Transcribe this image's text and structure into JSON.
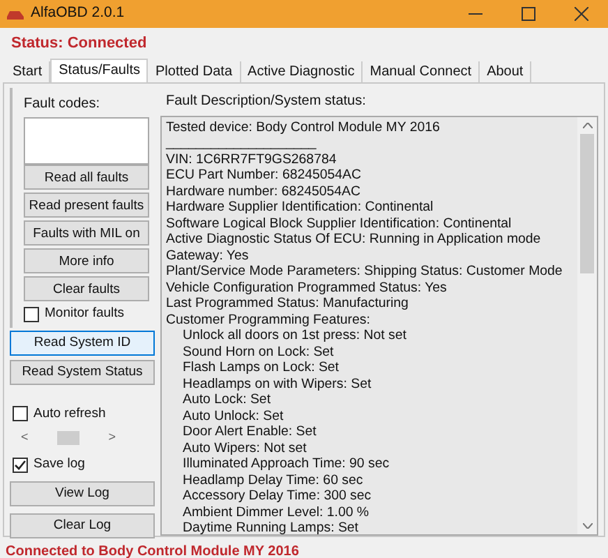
{
  "window": {
    "title": "AlfaOBD 2.0.1"
  },
  "status": "Status: Connected",
  "tabs": [
    {
      "label": "Start",
      "selected": false
    },
    {
      "label": "Status/Faults",
      "selected": true
    },
    {
      "label": "Plotted Data",
      "selected": false
    },
    {
      "label": "Active Diagnostic",
      "selected": false
    },
    {
      "label": "Manual Connect",
      "selected": false
    },
    {
      "label": "About",
      "selected": false
    }
  ],
  "fault_codes": {
    "label": "Fault codes:"
  },
  "fault_buttons": [
    "Read all faults",
    "Read present faults",
    "Faults with MIL on",
    "More info",
    "Clear faults"
  ],
  "monitor_faults": {
    "label": "Monitor faults",
    "checked": false
  },
  "system_buttons": [
    {
      "label": "Read System ID",
      "selected": true
    },
    {
      "label": "Read System Status",
      "selected": false
    }
  ],
  "auto_refresh": {
    "label": "Auto refresh",
    "checked": false
  },
  "slider_arrows": [
    "<",
    ">"
  ],
  "save_log": {
    "label": "Save log",
    "checked": true
  },
  "log_buttons": [
    "View Log",
    "Clear Log"
  ],
  "description": {
    "label": "Fault Description/System status:",
    "lines": [
      {
        "text": "Tested device: Body Control Module MY 2016"
      },
      {
        "text": "____________________"
      },
      {
        "text": "VIN: 1C6RR7FT9GS268784"
      },
      {
        "text": "ECU Part Number: 68245054AC"
      },
      {
        "text": "Hardware number: 68245054AC"
      },
      {
        "text": "Hardware Supplier Identification: Continental"
      },
      {
        "text": "Software Logical Block Supplier Identification: Continental"
      },
      {
        "text": "Active Diagnostic Status Of ECU: Running in Application mode"
      },
      {
        "text": "Gateway: Yes"
      },
      {
        "text": "Plant/Service Mode Parameters: Shipping Status: Customer Mode"
      },
      {
        "text": "Vehicle Configuration Programmed Status: Yes"
      },
      {
        "text": "Last Programmed Status: Manufacturing"
      },
      {
        "text": "Customer Programming Features:",
        "children": [
          {
            "text": "Unlock all doors on 1st press: Not set"
          },
          {
            "text": "Sound Horn on Lock: Set"
          },
          {
            "text": "Flash Lamps on Lock: Set"
          },
          {
            "text": "Headlamps on with Wipers: Set"
          },
          {
            "text": "Auto Lock: Set"
          },
          {
            "text": "Auto Unlock: Set"
          },
          {
            "text": "Door Alert Enable: Set"
          },
          {
            "text": "Auto Wipers: Not set"
          },
          {
            "text": "Illuminated Approach Time: 90 sec"
          },
          {
            "text": "Headlamp Delay Time: 60 sec"
          },
          {
            "text": "Accessory Delay Time: 300 sec"
          },
          {
            "text": "Ambient Dimmer Level: 1.00 %"
          },
          {
            "text": "Daytime Running Lamps: Set"
          }
        ]
      }
    ]
  },
  "status_bar": "Connected to Body Control Module MY 2016"
}
